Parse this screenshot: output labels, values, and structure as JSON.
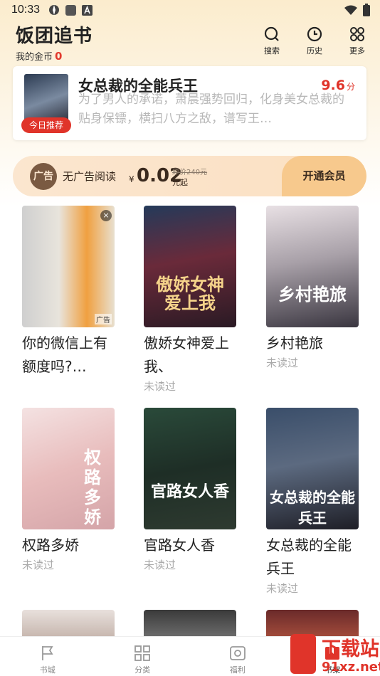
{
  "status_bar": {
    "time": "10:33"
  },
  "header": {
    "app_title": "饭团追书",
    "coins_label": "我的金币",
    "coins_value": "0",
    "buttons": [
      {
        "label": "搜索",
        "icon": "search-icon"
      },
      {
        "label": "历史",
        "icon": "clock-icon"
      },
      {
        "label": "更多",
        "icon": "grid-icon"
      }
    ]
  },
  "recommend": {
    "tag": "今日推荐",
    "title": "女总裁的全能兵王",
    "score": "9.6",
    "score_unit": "分",
    "description": "为了男人的承诺，萧晨强势回归，化身美女总裁的贴身保镖，横扫八方之敌，谱写王…"
  },
  "vip_banner": {
    "icon_text": "广告",
    "label": "无广告阅读",
    "currency": "¥",
    "price": "0.02",
    "original_price": "原价240元",
    "unit": "元起",
    "button": "开通会员"
  },
  "books": [
    {
      "title": "你的微信上有额度吗?…",
      "status": "",
      "cover_text": "",
      "is_ad": true,
      "ad_label": "广告"
    },
    {
      "title": "傲娇女神爱上我、",
      "status": "未读过",
      "cover_text": "傲娇女神爱上我"
    },
    {
      "title": "乡村艳旅",
      "status": "未读过",
      "cover_text": "乡村艳旅"
    },
    {
      "title": "权路多娇",
      "status": "未读过",
      "cover_text": "权路多娇"
    },
    {
      "title": "官路女人香",
      "status": "未读过",
      "cover_text": "官路女人香"
    },
    {
      "title": "女总裁的全能兵王",
      "status": "未读过",
      "cover_text": "女总裁的全能兵王"
    }
  ],
  "tabbar": [
    {
      "label": "书城",
      "icon": "flag-icon"
    },
    {
      "label": "分类",
      "icon": "category-icon"
    },
    {
      "label": "福利",
      "icon": "gift-icon"
    },
    {
      "label": "书架",
      "icon": "bookshelf-icon",
      "active": true
    }
  ],
  "watermark": {
    "brand": "下载站",
    "domain": "91xz.net"
  }
}
